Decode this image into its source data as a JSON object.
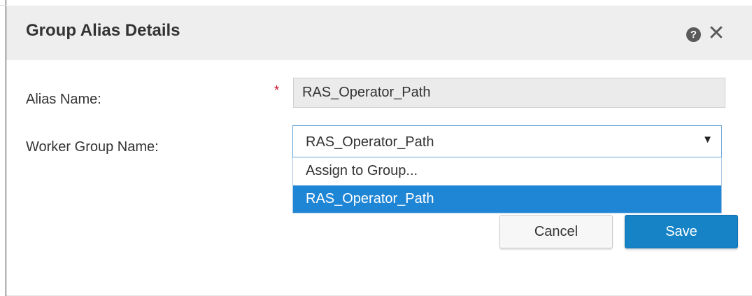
{
  "dialog": {
    "title": "Group Alias Details",
    "help_icon": "?",
    "close_icon": "✕"
  },
  "form": {
    "alias_name": {
      "label": "Alias Name:",
      "required_mark": "*",
      "value": "RAS_Operator_Path"
    },
    "worker_group": {
      "label": "Worker Group Name:",
      "selected_value": "RAS_Operator_Path",
      "caret": "▼",
      "options": [
        {
          "label": "Assign to Group...",
          "selected": false
        },
        {
          "label": "RAS_Operator_Path",
          "selected": true
        }
      ]
    }
  },
  "buttons": {
    "cancel_label": "Cancel",
    "save_label": "Save"
  },
  "colors": {
    "header_bg": "#eeeeee",
    "accent": "#1583c6",
    "selected_option": "#1f86d6",
    "required": "#d0021b"
  }
}
